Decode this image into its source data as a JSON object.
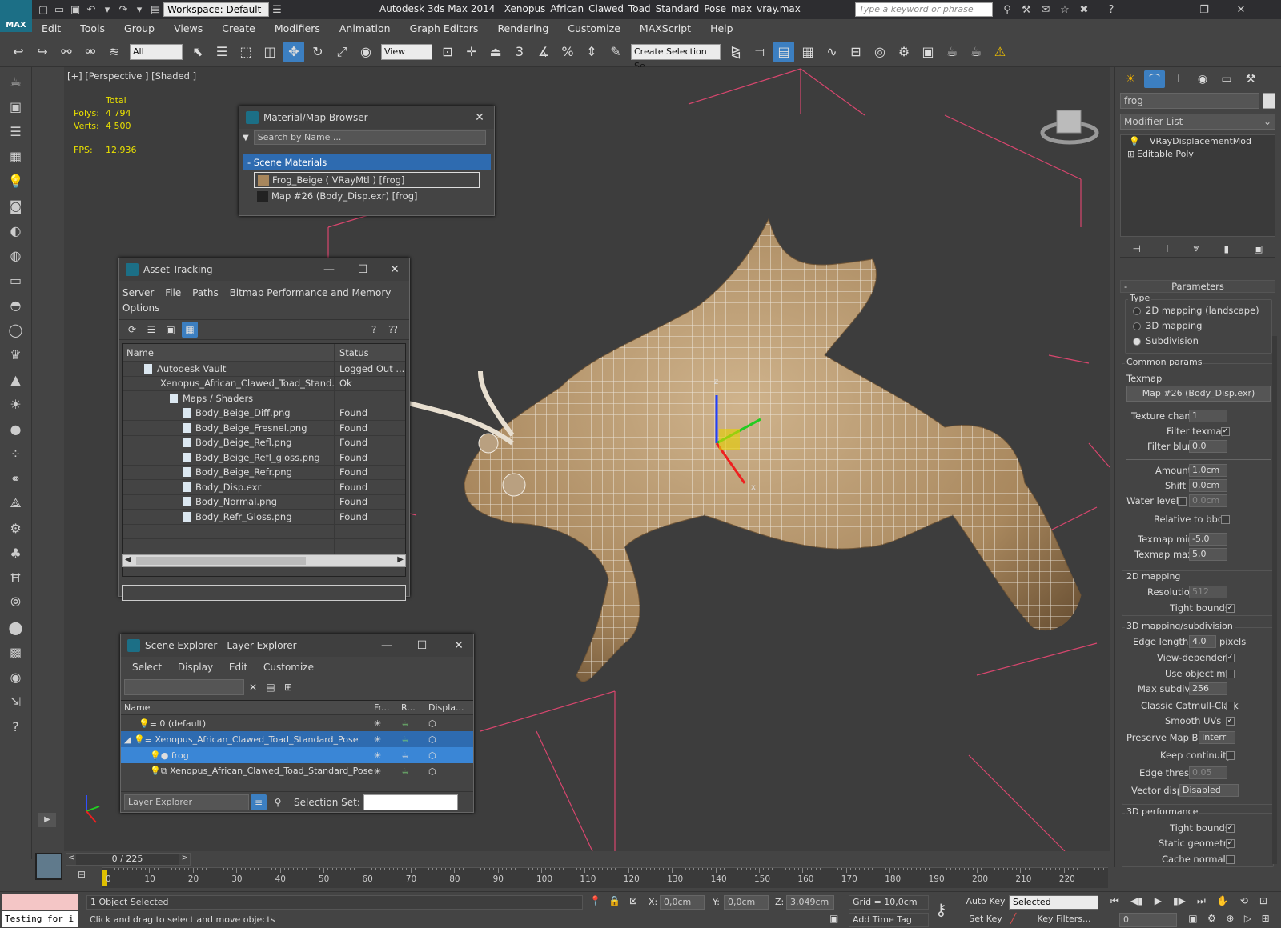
{
  "title": {
    "app": "Autodesk 3ds Max  2014",
    "file": "Xenopus_African_Clawed_Toad_Standard_Pose_max_vray.max",
    "workspace": "Workspace: Default",
    "search_placeholder": "Type a keyword or phrase",
    "logo": "MAX"
  },
  "menu": [
    "Edit",
    "Tools",
    "Group",
    "Views",
    "Create",
    "Modifiers",
    "Animation",
    "Graph Editors",
    "Rendering",
    "Customize",
    "MAXScript",
    "Help"
  ],
  "toolbar": {
    "filter": "All",
    "ref_coord": "View",
    "selection_set": "Create Selection Se",
    "snap3": "3",
    "snap_angle": "%"
  },
  "viewport": {
    "label": "[+] [Perspective ] [Shaded ]",
    "stats": {
      "total": "Total",
      "polys_label": "Polys:",
      "polys": "4 794",
      "verts_label": "Verts:",
      "verts": "4 500",
      "fps_label": "FPS:",
      "fps": "12,936"
    },
    "axis_x": "x",
    "axis_y": "y",
    "axis_z": "z"
  },
  "material_browser": {
    "title": "Material/Map Browser",
    "search": "Search by Name ...",
    "group": "- Scene Materials",
    "items": [
      "Frog_Beige  ( VRayMtl ) [frog]",
      "Map #26 (Body_Disp.exr)  [frog]"
    ]
  },
  "asset_tracking": {
    "title": "Asset Tracking",
    "menu": [
      "Server",
      "File",
      "Paths",
      "Bitmap Performance and Memory",
      "Options"
    ],
    "col_name": "Name",
    "col_status": "Status",
    "rows": [
      {
        "name": "Autodesk Vault",
        "status": "Logged Out ..."
      },
      {
        "name": "Xenopus_African_Clawed_Toad_Stand...",
        "status": "Ok"
      },
      {
        "name": "Maps / Shaders",
        "status": ""
      },
      {
        "name": "Body_Beige_Diff.png",
        "status": "Found"
      },
      {
        "name": "Body_Beige_Fresnel.png",
        "status": "Found"
      },
      {
        "name": "Body_Beige_Refl.png",
        "status": "Found"
      },
      {
        "name": "Body_Beige_Refl_gloss.png",
        "status": "Found"
      },
      {
        "name": "Body_Beige_Refr.png",
        "status": "Found"
      },
      {
        "name": "Body_Disp.exr",
        "status": "Found"
      },
      {
        "name": "Body_Normal.png",
        "status": "Found"
      },
      {
        "name": "Body_Refr_Gloss.png",
        "status": "Found"
      }
    ]
  },
  "scene_explorer": {
    "title": "Scene Explorer - Layer Explorer",
    "menu": [
      "Select",
      "Display",
      "Edit",
      "Customize"
    ],
    "cols": [
      "Name",
      "Fr...",
      "R...",
      "Displa..."
    ],
    "rows": [
      "0 (default)",
      "Xenopus_African_Clawed_Toad_Standard_Pose",
      "frog",
      "Xenopus_African_Clawed_Toad_Standard_Pose"
    ],
    "footer_mode": "Layer Explorer",
    "selection_set_label": "Selection Set:"
  },
  "command_panel": {
    "object_name": "frog",
    "modifier_list": "Modifier List",
    "stack": [
      "VRayDisplacementMod",
      "Editable Poly"
    ],
    "params_title": "Parameters",
    "type_label": "Type",
    "type_options": [
      "2D mapping (landscape)",
      "3D mapping",
      "Subdivision"
    ],
    "common": "Common params",
    "texmap": "Texmap",
    "texmap_value": "Map #26 (Body_Disp.exr)",
    "texture_chan": "Texture chan",
    "texture_chan_v": "1",
    "filter_texmap": "Filter texmap",
    "filter_blur": "Filter blur",
    "filter_blur_v": "0,0",
    "amount": "Amount",
    "amount_v": "1,0cm",
    "shift": "Shift",
    "shift_v": "0,0cm",
    "water": "Water level",
    "water_v": "0,0cm",
    "relbbox": "Relative to bbox",
    "tmin": "Texmap min",
    "tmin_v": "-5,0",
    "tmax": "Texmap max",
    "tmax_v": "5,0",
    "m2d": "2D mapping",
    "res": "Resolution",
    "res_v": "512",
    "tight": "Tight bounds",
    "m3d": "3D mapping/subdivision",
    "edge": "Edge length",
    "edge_v": "4,0",
    "pixels": "pixels",
    "viewdep": "View-dependent",
    "useobj": "Use object mtl",
    "maxsub": "Max subdivs",
    "maxsub_v": "256",
    "catmull": "Classic Catmull-Clark",
    "smooth": "Smooth UVs",
    "preserve": "Preserve Map Bnd",
    "preserve_v": "Interr",
    "keep": "Keep continuity",
    "edgethresh": "Edge thresh",
    "edgethresh_v": "0,05",
    "vector": "Vector displ",
    "vector_v": "Disabled",
    "perf": "3D performance",
    "tight2": "Tight bounds",
    "static": "Static geometry",
    "cache": "Cache normals"
  },
  "timeline": {
    "frame": "0 / 225",
    "ticks": [
      "0",
      "10",
      "20",
      "30",
      "40",
      "50",
      "60",
      "70",
      "80",
      "90",
      "100",
      "110",
      "120",
      "130",
      "140",
      "150",
      "160",
      "170",
      "180",
      "190",
      "200",
      "210",
      "220"
    ]
  },
  "status": {
    "maxscript": "Testing for i",
    "selected": "1 Object Selected",
    "prompt": "Click and drag to select and move objects",
    "x_label": "X:",
    "x": "0,0cm",
    "y_label": "Y:",
    "y": "0,0cm",
    "z_label": "Z:",
    "z": "3,049cm",
    "grid": "Grid = 10,0cm",
    "add_time_tag": "Add Time Tag",
    "auto_key": "Auto Key",
    "set_key": "Set Key",
    "key_mode": "Selected",
    "key_filters": "Key Filters...",
    "frame_field": "0"
  }
}
